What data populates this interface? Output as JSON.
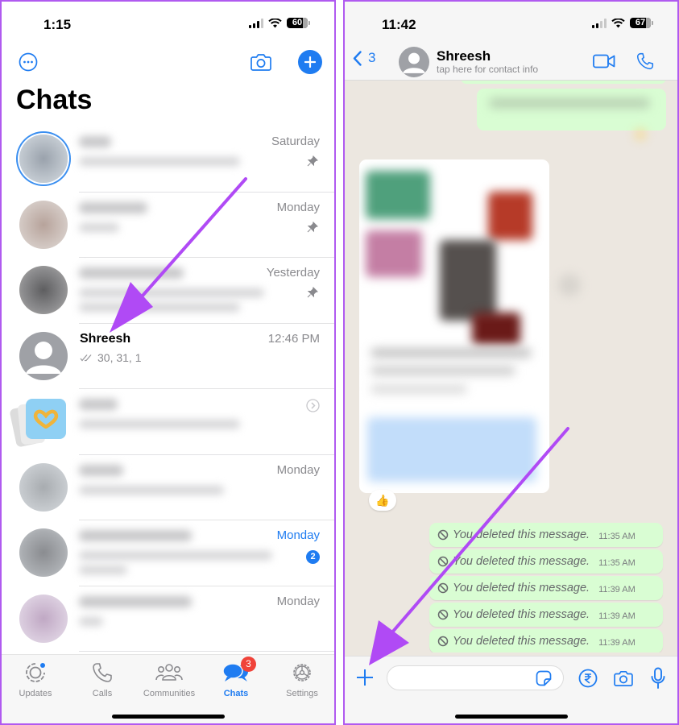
{
  "left_screen": {
    "status_bar": {
      "time": "1:15",
      "battery": "60"
    },
    "title": "Chats",
    "chats": [
      {
        "when": "Saturday",
        "pinned": true,
        "blurred": true
      },
      {
        "when": "Monday",
        "pinned": true,
        "blurred": true
      },
      {
        "when": "Yesterday",
        "pinned": true,
        "blurred": true
      },
      {
        "name": "Shreesh",
        "preview": "30, 31, 1",
        "when": "12:46 PM",
        "pinned": false,
        "blurred": false
      },
      {
        "when": "",
        "pinned": false,
        "blurred": true,
        "type": "channel"
      },
      {
        "when": "Monday",
        "pinned": false,
        "blurred": true
      },
      {
        "when": "Monday",
        "pinned": false,
        "blurred": true,
        "unread": "2",
        "highlight": true
      },
      {
        "when": "Monday",
        "pinned": false,
        "blurred": true
      }
    ],
    "tabbar": {
      "tabs": [
        {
          "label": "Updates",
          "icon": "updates-icon"
        },
        {
          "label": "Calls",
          "icon": "phone-icon"
        },
        {
          "label": "Communities",
          "icon": "communities-icon"
        },
        {
          "label": "Chats",
          "icon": "chats-icon",
          "badge": "3",
          "active": true
        },
        {
          "label": "Settings",
          "icon": "gear-icon"
        }
      ]
    }
  },
  "right_screen": {
    "status_bar": {
      "time": "11:42",
      "battery": "67"
    },
    "header": {
      "back_count": "3",
      "contact_name": "Shreesh",
      "subtitle": "tap here for contact info"
    },
    "reaction": "👍",
    "deleted_messages": [
      {
        "text": "You deleted this message.",
        "time": "11:35 AM"
      },
      {
        "text": "You deleted this message.",
        "time": "11:35 AM"
      },
      {
        "text": "You deleted this message.",
        "time": "11:39 AM"
      },
      {
        "text": "You deleted this message.",
        "time": "11:39 AM"
      },
      {
        "text": "You deleted this message.",
        "time": "11:39 AM"
      }
    ],
    "composer": {
      "placeholder": ""
    }
  },
  "colors": {
    "accent": "#1f7cf1",
    "annotation_arrow": "#b04af5",
    "outgoing_bubble": "#d9fdd3",
    "badge_red": "#f0433a"
  }
}
